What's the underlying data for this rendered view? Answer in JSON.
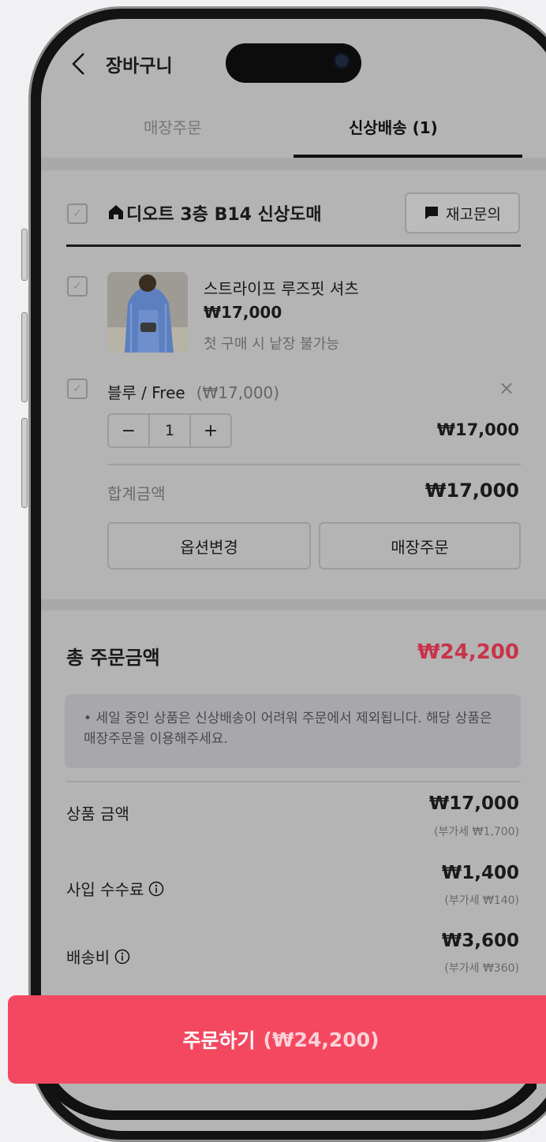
{
  "header": {
    "title": "장바구니"
  },
  "tabs": [
    {
      "label": "매장주문",
      "active": false
    },
    {
      "label": "신상배송 (1)",
      "active": true
    }
  ],
  "store": {
    "name": "디오트 3층 B14 신상도매",
    "inquiry_label": "재고문의"
  },
  "product": {
    "name": "스트라이프 루즈핏 셔츠",
    "price": "₩17,000",
    "note": "첫 구매 시 낱장 불가능",
    "option": {
      "label": "블루 / Free",
      "price": "(₩17,000)",
      "quantity": "1",
      "line_total": "₩17,000",
      "minus": "−",
      "plus": "+",
      "remove": "×"
    },
    "sum_label": "합계금액",
    "sum_value": "₩17,000",
    "change_option_label": "옵션변경",
    "store_order_label": "매장주문"
  },
  "summary": {
    "total_label": "총 주문금액",
    "total_value": "₩24,200",
    "notice": "• 세일 중인 상품은 신상배송이 어려워 주문에서 제외됩니다. 해당 상품은 매장주문을 이용해주세요.",
    "rows": [
      {
        "label": "상품 금액",
        "value": "₩17,000",
        "vat": "(부가세 ₩1,700)"
      },
      {
        "label": "사입 수수료",
        "value": "₩1,400",
        "vat": "(부가세 ₩140)"
      },
      {
        "label": "배송비",
        "value": "₩3,600",
        "vat": "(부가세 ₩360)"
      }
    ]
  },
  "cta": {
    "label": "주문하기",
    "price": "(₩24,200)"
  },
  "colors": {
    "accent": "#f44860",
    "total": "#c8334a"
  }
}
